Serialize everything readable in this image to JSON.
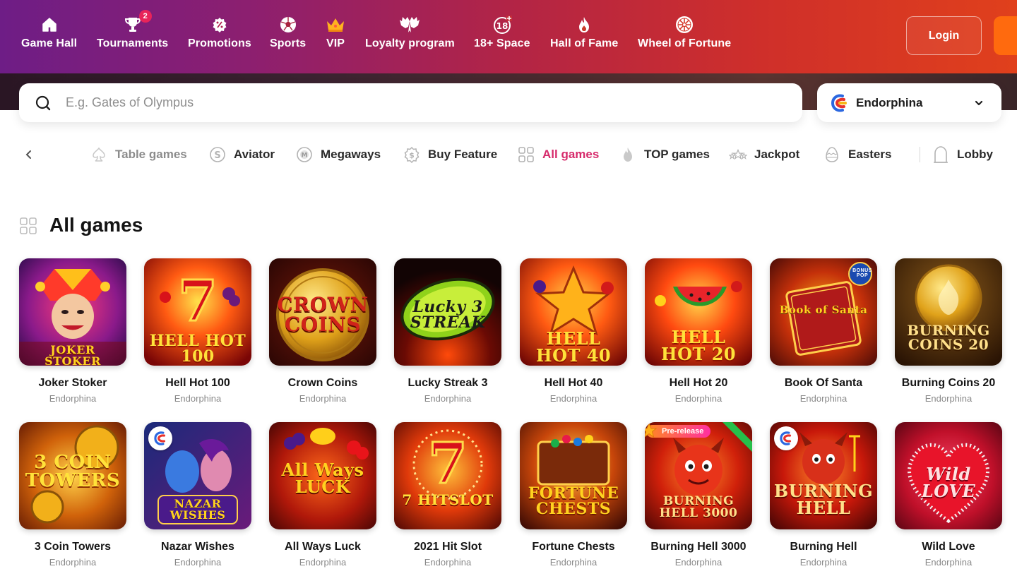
{
  "header": {
    "nav": [
      {
        "label": "Game Hall",
        "icon": "home-icon"
      },
      {
        "label": "Tournaments",
        "icon": "trophy-icon",
        "badge": "2"
      },
      {
        "label": "Promotions",
        "icon": "percent-badge-icon"
      },
      {
        "label": "Sports",
        "icon": "soccer-ball-icon"
      },
      {
        "label": "VIP",
        "icon": "crown-icon"
      },
      {
        "label": "Loyalty program",
        "icon": "wings-icon"
      },
      {
        "label": "18+ Space",
        "icon": "eighteen-plus-icon"
      },
      {
        "label": "Hall of Fame",
        "icon": "flame-icon"
      },
      {
        "label": "Wheel of Fortune",
        "icon": "wheel-icon"
      }
    ],
    "login_label": "Login",
    "colors": {
      "gradient_start": "#6e1d86",
      "gradient_end": "#e0401c",
      "register": "#ff6a0e"
    }
  },
  "search": {
    "placeholder": "E.g. Gates of Olympus",
    "value": "",
    "provider": "Endorphina"
  },
  "categories": [
    {
      "label": "Table games",
      "icon": "table-games-icon",
      "state": "dim"
    },
    {
      "label": "Aviator",
      "icon": "aviator-icon",
      "state": "normal"
    },
    {
      "label": "Megaways",
      "icon": "megaways-icon",
      "state": "normal"
    },
    {
      "label": "Buy Feature",
      "icon": "buy-feature-icon",
      "state": "normal"
    },
    {
      "label": "All games",
      "icon": "grid-icon",
      "state": "active"
    },
    {
      "label": "TOP games",
      "icon": "flame-icon",
      "state": "normal"
    },
    {
      "label": "Jackpot",
      "icon": "stars-icon",
      "state": "normal"
    },
    {
      "label": "Easters",
      "icon": "egg-icon",
      "state": "normal"
    },
    {
      "label": "Lobby",
      "icon": "lobby-icon",
      "state": "normal"
    }
  ],
  "section": {
    "title": "All games",
    "active_color": "#d62a6b"
  },
  "games": [
    {
      "name": "Joker Stoker",
      "provider": "Endorphina",
      "art": "JOKER STOKER"
    },
    {
      "name": "Hell Hot 100",
      "provider": "Endorphina",
      "art": "HELL HOT 100"
    },
    {
      "name": "Crown Coins",
      "provider": "Endorphina",
      "art": "CROWN COINS"
    },
    {
      "name": "Lucky Streak 3",
      "provider": "Endorphina",
      "art": "Lucky 3 STREAK"
    },
    {
      "name": "Hell Hot 40",
      "provider": "Endorphina",
      "art": "HELL HOT 40"
    },
    {
      "name": "Hell Hot 20",
      "provider": "Endorphina",
      "art": "HELL HOT 20"
    },
    {
      "name": "Book Of Santa",
      "provider": "Endorphina",
      "art": "Book of Santa",
      "badge": "BONUS POP"
    },
    {
      "name": "Burning Coins 20",
      "provider": "Endorphina",
      "art": "BURNING COINS 20"
    },
    {
      "name": "3 Coin Towers",
      "provider": "Endorphina",
      "art": "3 COIN TOWERS"
    },
    {
      "name": "Nazar Wishes",
      "provider": "Endorphina",
      "art": "NAZAR WISHES"
    },
    {
      "name": "All Ways Luck",
      "provider": "Endorphina",
      "art": "All Ways LUCK"
    },
    {
      "name": "2021 Hit Slot",
      "provider": "Endorphina",
      "art": "7 HITSLOT"
    },
    {
      "name": "Fortune Chests",
      "provider": "Endorphina",
      "art": "FORTUNE CHESTS"
    },
    {
      "name": "Burning Hell 3000",
      "provider": "Endorphina",
      "art": "BURNING HELL 3000",
      "tag": "Pre-release"
    },
    {
      "name": "Burning Hell",
      "provider": "Endorphina",
      "art": "BURNING HELL"
    },
    {
      "name": "Wild Love",
      "provider": "Endorphina",
      "art": "Wild LOVE"
    }
  ]
}
